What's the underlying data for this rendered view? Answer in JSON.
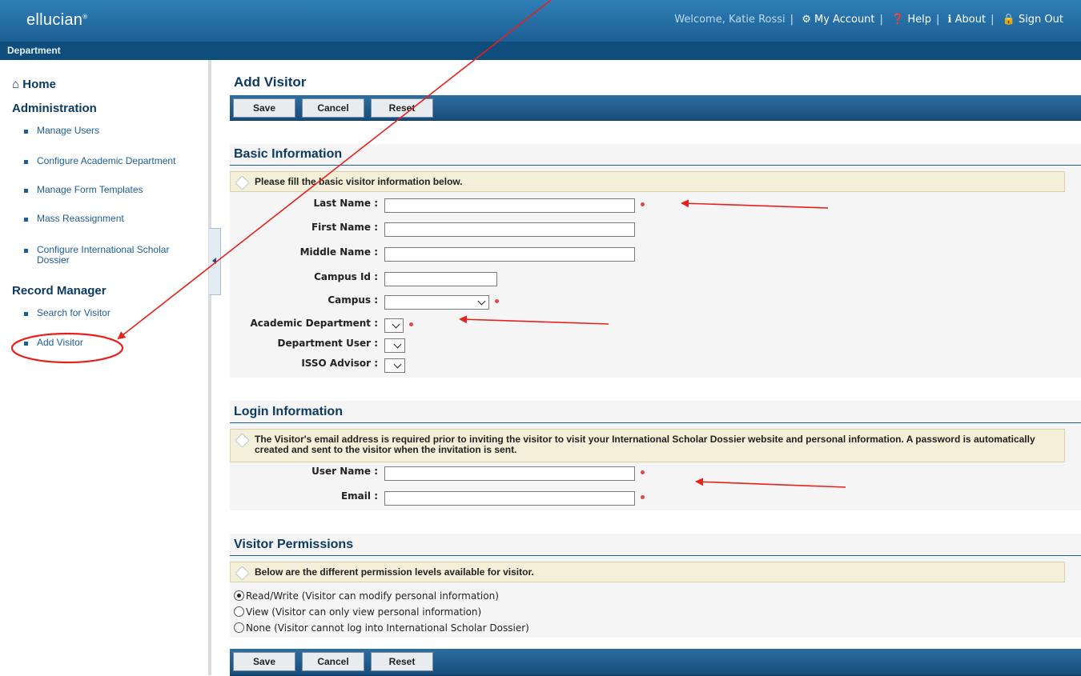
{
  "header": {
    "logo": "ellucian",
    "logo_mark": "®",
    "welcome": "Welcome, Katie Rossi",
    "my_account": "My Account",
    "help": "Help",
    "about": "About",
    "sign_out": "Sign Out",
    "department_label": "Department"
  },
  "sidebar": {
    "home": "Home",
    "administration_heading": "Administration",
    "admin_items": [
      "Manage Users",
      "Configure Academic Department",
      "Manage Form Templates",
      "Mass Reassignment",
      "Configure International Scholar Dossier"
    ],
    "record_heading": "Record Manager",
    "record_items": [
      "Search for Visitor",
      "Add Visitor"
    ]
  },
  "page": {
    "title": "Add Visitor",
    "buttons": {
      "save": "Save",
      "cancel": "Cancel",
      "reset": "Reset"
    }
  },
  "basic": {
    "title": "Basic Information",
    "info": "Please fill the basic visitor information below.",
    "labels": {
      "last_name": "Last Name :",
      "first_name": "First Name :",
      "middle_name": "Middle Name :",
      "campus_id": "Campus Id :",
      "campus": "Campus :",
      "academic_department": "Academic Department :",
      "department_user": "Department User :",
      "isso_advisor": "ISSO Advisor :"
    },
    "values": {
      "last_name": "",
      "first_name": "",
      "middle_name": "",
      "campus_id": "",
      "campus": "",
      "academic_department": "",
      "department_user": "",
      "isso_advisor": ""
    }
  },
  "login": {
    "title": "Login Information",
    "info": "The Visitor's email address is required prior to inviting the visitor to visit your International Scholar Dossier website and personal information. A password is automatically created and sent to the visitor when the invitation is sent.",
    "labels": {
      "user_name": "User Name :",
      "email": "Email :"
    },
    "values": {
      "user_name": "",
      "email": ""
    }
  },
  "permissions": {
    "title": "Visitor Permissions",
    "info": "Below are the different permission levels available for visitor.",
    "options": [
      {
        "label": "Read/Write (Visitor can modify personal information)",
        "selected": true
      },
      {
        "label": "View (Visitor can only view personal information)",
        "selected": false
      },
      {
        "label": "None (Visitor cannot log into International Scholar Dossier)",
        "selected": false
      }
    ]
  },
  "colors": {
    "brand_blue": "#1b5f94",
    "heading_navy": "#0d3a61",
    "required_dot": "#e0474c",
    "annotation_red": "#e8201b",
    "info_bg": "#f3efd8"
  },
  "icons": [
    "home-icon",
    "gear-icon",
    "question-circle-icon",
    "info-circle-icon",
    "lock-icon",
    "tag-icon",
    "chevron-down-icon",
    "collapse-left-icon"
  ]
}
